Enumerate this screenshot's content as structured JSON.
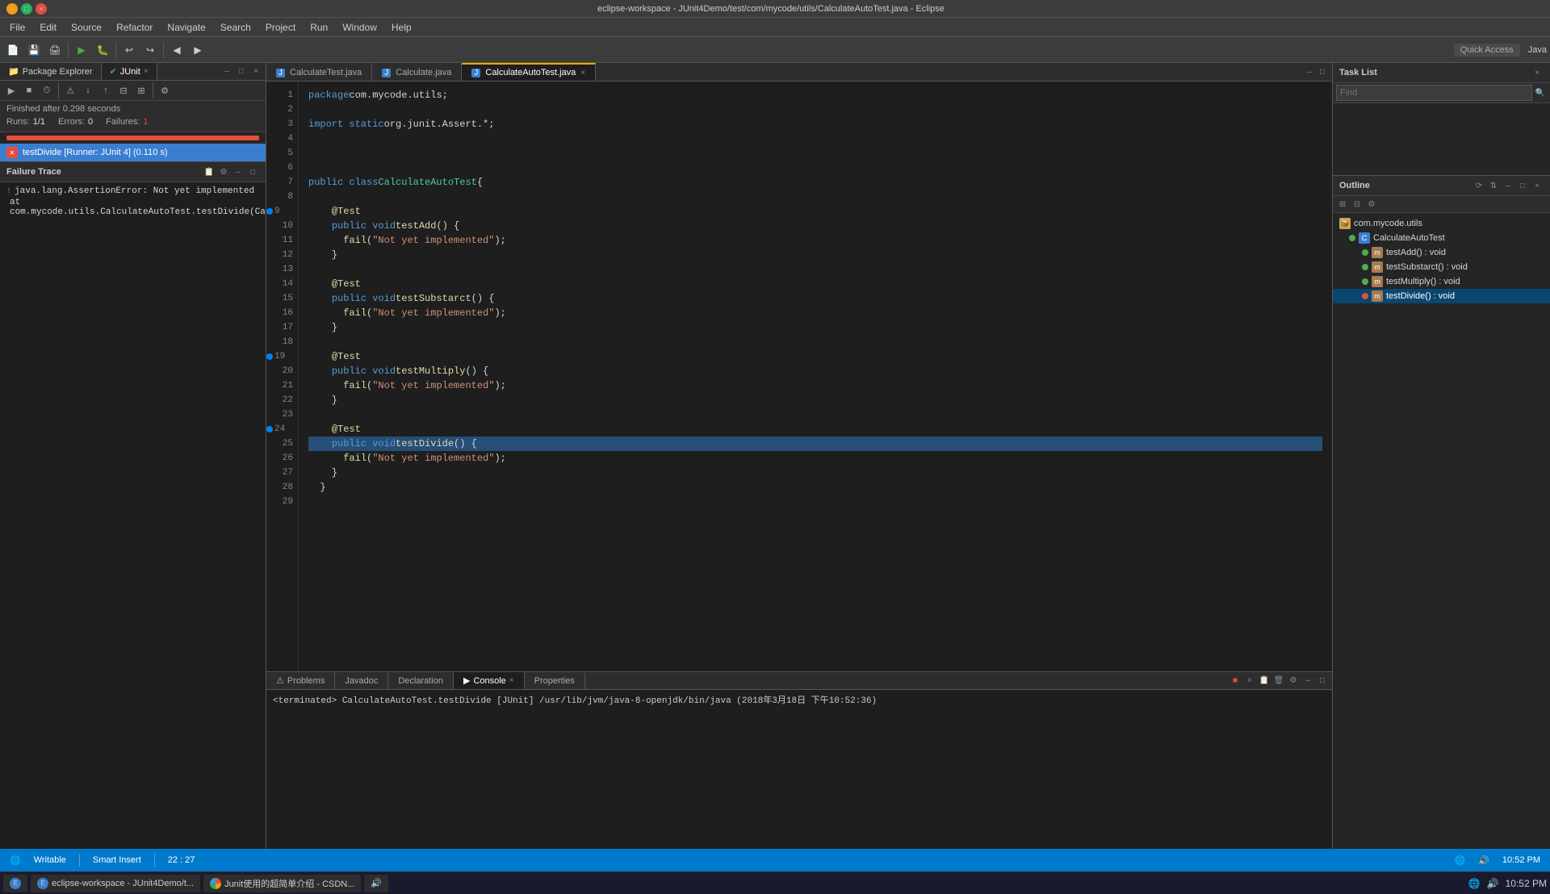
{
  "titleBar": {
    "title": "eclipse-workspace - JUnit4Demo/test/com/mycode/utils/CalculateAutoTest.java - Eclipse"
  },
  "menuBar": {
    "items": [
      "File",
      "Edit",
      "Source",
      "Refactor",
      "Navigate",
      "Search",
      "Project",
      "Run",
      "Window",
      "Help"
    ]
  },
  "toolbar": {
    "quickAccess": "Quick Access",
    "perspective": "Java"
  },
  "leftPanel": {
    "tabs": [
      {
        "label": "Package Explorer",
        "active": false
      },
      {
        "label": "JUnit",
        "active": true,
        "closable": true
      }
    ],
    "junit": {
      "finishedText": "Finished after 0.298 seconds",
      "runs": "1/1",
      "errors": "0",
      "failures": "1",
      "testItem": "testDivide [Runner: JUnit 4] (0.110 s)",
      "failureTrace": {
        "header": "Failure Trace",
        "lines": [
          "java.lang.AssertionError: Not yet implemented",
          "at com.mycode.utils.CalculateAutoTest.testDivide(CalculateAutoTe..."
        ]
      }
    }
  },
  "editorTabs": [
    {
      "label": "CalculateTest.java",
      "active": false,
      "closable": false,
      "icon": "J"
    },
    {
      "label": "Calculate.java",
      "active": false,
      "closable": false,
      "icon": "J"
    },
    {
      "label": "CalculateAutoTest.java",
      "active": true,
      "closable": true,
      "icon": "J"
    }
  ],
  "codeEditor": {
    "lines": [
      {
        "num": 1,
        "code": "  package com.mycode.utils;",
        "type": "normal"
      },
      {
        "num": 2,
        "code": "",
        "type": "normal"
      },
      {
        "num": 3,
        "code": "  import static org.junit.Assert.*;",
        "type": "import-static"
      },
      {
        "num": 4,
        "code": "",
        "type": "normal"
      },
      {
        "num": 5,
        "code": "",
        "type": "normal"
      },
      {
        "num": 6,
        "code": "",
        "type": "normal"
      },
      {
        "num": 7,
        "code": "  public class CalculateAutoTest {",
        "type": "class-decl"
      },
      {
        "num": 8,
        "code": "",
        "type": "normal"
      },
      {
        "num": 9,
        "code": "    @Test",
        "type": "annotation",
        "bp": "blue"
      },
      {
        "num": 10,
        "code": "    public void testAdd() {",
        "type": "method"
      },
      {
        "num": 11,
        "code": "      fail(\"Not yet implemented\");",
        "type": "fail"
      },
      {
        "num": 12,
        "code": "    }",
        "type": "normal"
      },
      {
        "num": 13,
        "code": "",
        "type": "normal"
      },
      {
        "num": 14,
        "code": "    @Test",
        "type": "annotation"
      },
      {
        "num": 15,
        "code": "    public void testSubstarct() {",
        "type": "method"
      },
      {
        "num": 16,
        "code": "      fail(\"Not yet implemented\");",
        "type": "fail"
      },
      {
        "num": 17,
        "code": "    }",
        "type": "normal"
      },
      {
        "num": 18,
        "code": "",
        "type": "normal"
      },
      {
        "num": 19,
        "code": "    @Test",
        "type": "annotation",
        "bp": "blue"
      },
      {
        "num": 20,
        "code": "    public void testMultiply() {",
        "type": "method"
      },
      {
        "num": 21,
        "code": "      fail(\"Not yet implemented\");",
        "type": "fail"
      },
      {
        "num": 22,
        "code": "    }",
        "type": "normal"
      },
      {
        "num": 23,
        "code": "",
        "type": "normal"
      },
      {
        "num": 24,
        "code": "    @Test",
        "type": "annotation",
        "bp": "blue"
      },
      {
        "num": 25,
        "code": "    public void testDivide() {",
        "type": "method-highlighted"
      },
      {
        "num": 26,
        "code": "      fail(\"Not yet implemented\");",
        "type": "fail"
      },
      {
        "num": 27,
        "code": "    }",
        "type": "normal"
      },
      {
        "num": 28,
        "code": "  }",
        "type": "normal"
      },
      {
        "num": 29,
        "code": "",
        "type": "normal"
      }
    ]
  },
  "bottomPanel": {
    "tabs": [
      {
        "label": "Problems",
        "active": false
      },
      {
        "label": "Javadoc",
        "active": false
      },
      {
        "label": "Declaration",
        "active": false
      },
      {
        "label": "Console",
        "active": true,
        "closable": true
      },
      {
        "label": "Properties",
        "active": false
      }
    ],
    "console": {
      "content": "<terminated> CalculateAutoTest.testDivide [JUnit] /usr/lib/jvm/java-8-openjdk/bin/java (2018年3月18日 下午10:52:36)"
    }
  },
  "rightPanel": {
    "taskList": {
      "title": "Task List",
      "findPlaceholder": "Find"
    },
    "outline": {
      "title": "Outline",
      "items": [
        {
          "label": "com.mycode.utils",
          "level": 0,
          "icon": "package"
        },
        {
          "label": "CalculateAutoTest",
          "level": 1,
          "icon": "class",
          "active": false
        },
        {
          "label": "testAdd() : void",
          "level": 2,
          "icon": "method-red"
        },
        {
          "label": "testSubstarct() : void",
          "level": 2,
          "icon": "method-red"
        },
        {
          "label": "testMultiply() : void",
          "level": 2,
          "icon": "method-red"
        },
        {
          "label": "testDivide() : void",
          "level": 2,
          "icon": "method-red",
          "selected": true
        }
      ]
    }
  },
  "statusBar": {
    "writable": "Writable",
    "smartInsert": "Smart Insert",
    "position": "22 : 27",
    "time": "10:52 PM"
  },
  "taskbar": {
    "items": [
      {
        "label": "eclipse-workspace - JUnit4Demo/t..."
      },
      {
        "label": "Junit使用的超简单介绍 - CSDN..."
      }
    ],
    "sysIcons": [
      "🔊"
    ]
  }
}
